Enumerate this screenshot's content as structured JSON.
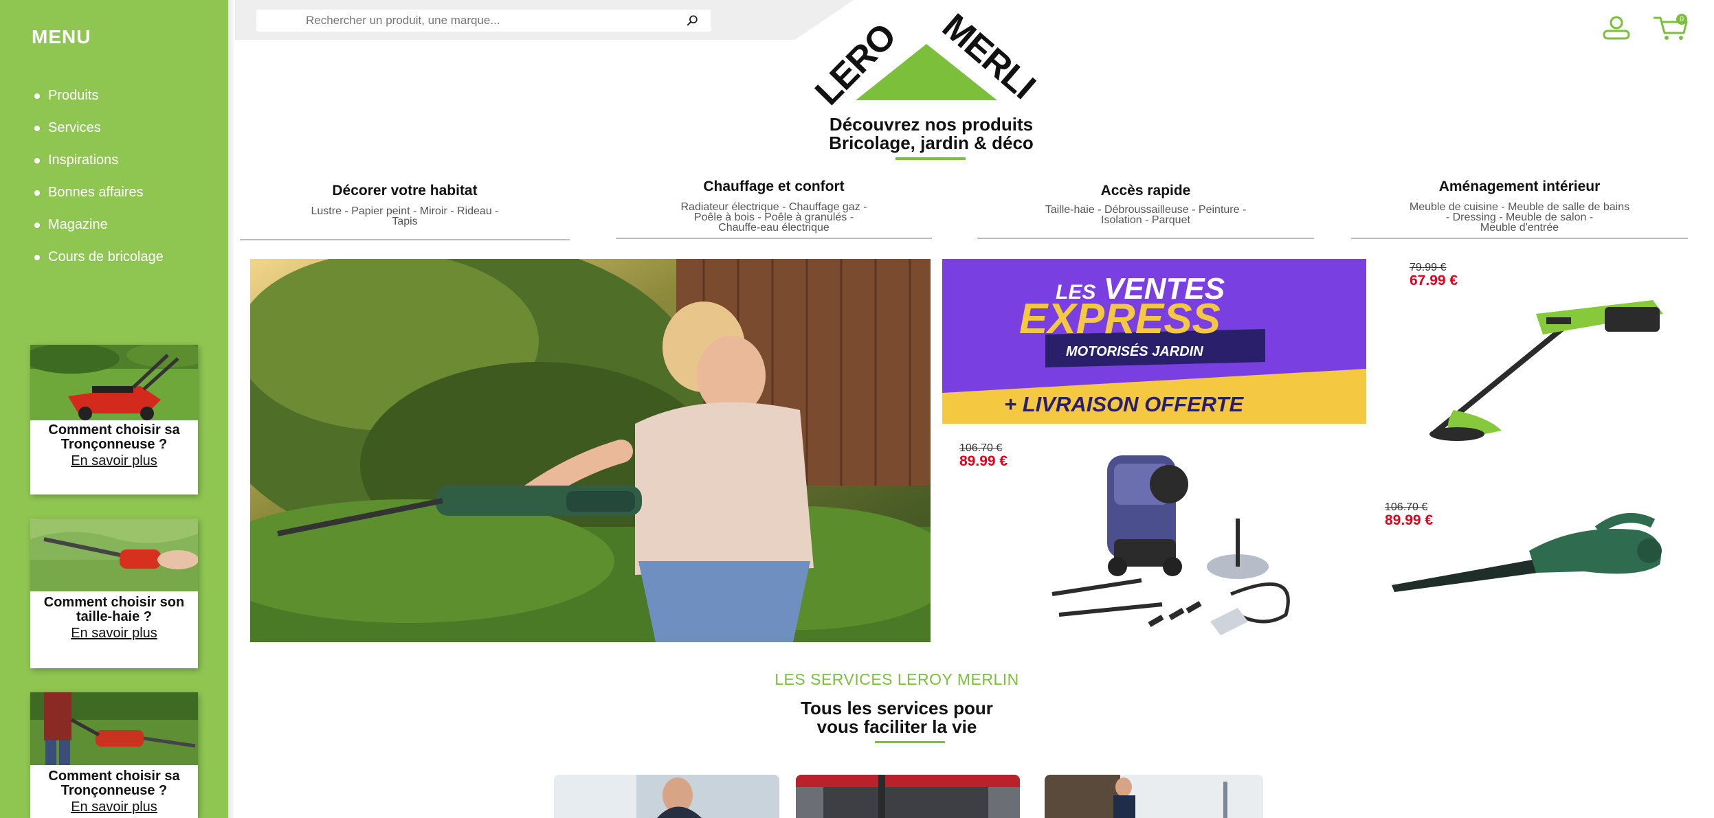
{
  "menu": {
    "title": "MENU",
    "items": [
      {
        "label": "Produits"
      },
      {
        "label": "Services"
      },
      {
        "label": "Inspirations"
      },
      {
        "label": "Bonnes affaires"
      },
      {
        "label": "Magazine"
      },
      {
        "label": "Cours de bricolage"
      }
    ]
  },
  "guides": [
    {
      "title": "Comment choisir sa Tronçonneuse ?",
      "link": "En savoir plus",
      "image": "lawn-mower-photo"
    },
    {
      "title": "Comment choisir son taille-haie ?",
      "link": "En savoir plus",
      "image": "hedge-trimmer-photo"
    },
    {
      "title": "Comment choisir sa Tronçonneuse ?",
      "link": "En savoir plus",
      "image": "person-trimmer-photo"
    }
  ],
  "search": {
    "placeholder": "Rechercher un produit, une marque..."
  },
  "brand": {
    "logo_text_1": "LEROY",
    "logo_text_2": "MERLIN",
    "accent_color": "#7cbf3b"
  },
  "header": {
    "heading_line1": "Découvrez nos produits",
    "heading_line2": "Bricolage, jardin & déco",
    "cart_count": "0"
  },
  "categories": [
    {
      "title": "Décorer votre habitat",
      "links": [
        "Lustre - Papier peint - Miroir - Rideau -",
        "Tapis"
      ]
    },
    {
      "title": "Chauffage et confort",
      "links": [
        "Radiateur électrique - Chauffage gaz -",
        "Poêle à bois - Poêle à granulés -",
        "Chauffe-eau électrique"
      ]
    },
    {
      "title": "Accès rapide",
      "links": [
        "Taille-haie - Débroussailleuse - Peinture -",
        "Isolation - Parquet"
      ]
    },
    {
      "title": "Aménagement intérieur",
      "links": [
        "Meuble de cuisine - Meuble de salle de bains",
        "- Dressing - Meuble de salon -",
        "Meuble d'entrée"
      ]
    }
  ],
  "promo": {
    "banner_line1": "LES",
    "banner_line2": "VENTES",
    "banner_line3": "EXPRESS",
    "banner_tag": "MOTORISÉS JARDIN",
    "banner_footer": "+ LIVRAISON OFFERTE",
    "banner_colors": {
      "purple": "#7a3fe0",
      "yellow": "#f5c842",
      "navy": "#2a1f6b"
    }
  },
  "products": [
    {
      "name": "string-trimmer",
      "old_price": "79.99 €",
      "new_price": "67.99 €"
    },
    {
      "name": "pressure-washer",
      "old_price": "106.70 €",
      "new_price": "89.99 €"
    },
    {
      "name": "leaf-blower",
      "old_price": "106.70 €",
      "new_price": "89.99 €"
    }
  ],
  "services": {
    "kicker": "LES SERVICES LEROY MERLIN",
    "heading_line1": "Tous les services pour",
    "heading_line2": "vous faciliter la vie"
  }
}
